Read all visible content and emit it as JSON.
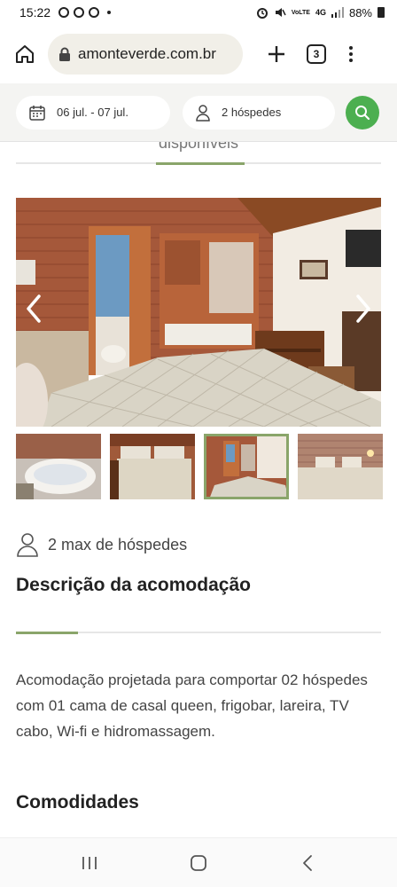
{
  "status_bar": {
    "time": "15:22",
    "network": "4G",
    "carrier_label": "Vo))\nLTE1",
    "battery": "88%"
  },
  "browser": {
    "url": "amonteverde.com.br",
    "tab_count": "3"
  },
  "search": {
    "dates": "06 jul. - 07 jul.",
    "guests": "2 hóspedes",
    "accent_color": "#4caf50"
  },
  "content": {
    "partial_heading": "disponíveis",
    "max_guests": "2 max de hóspedes",
    "description_title": "Descrição da acomodação",
    "description_text": "Acomodação projetada para comportar 02 hóspedes com 01 cama de casal queen, frigobar, lareira, TV cabo, Wi-fi e hidromassagem.",
    "amenities_title": "Comodidades",
    "accent_color": "#8aa56a"
  },
  "gallery": {
    "active_thumb_index": 2,
    "thumbnail_count": 4
  },
  "icons": {
    "home": "home-icon",
    "lock": "lock-icon",
    "plus": "plus-icon",
    "menu": "kebab-menu-icon",
    "calendar": "calendar-icon",
    "person": "person-icon",
    "search": "search-icon",
    "prev": "chevron-left-icon",
    "next": "chevron-right-icon"
  }
}
